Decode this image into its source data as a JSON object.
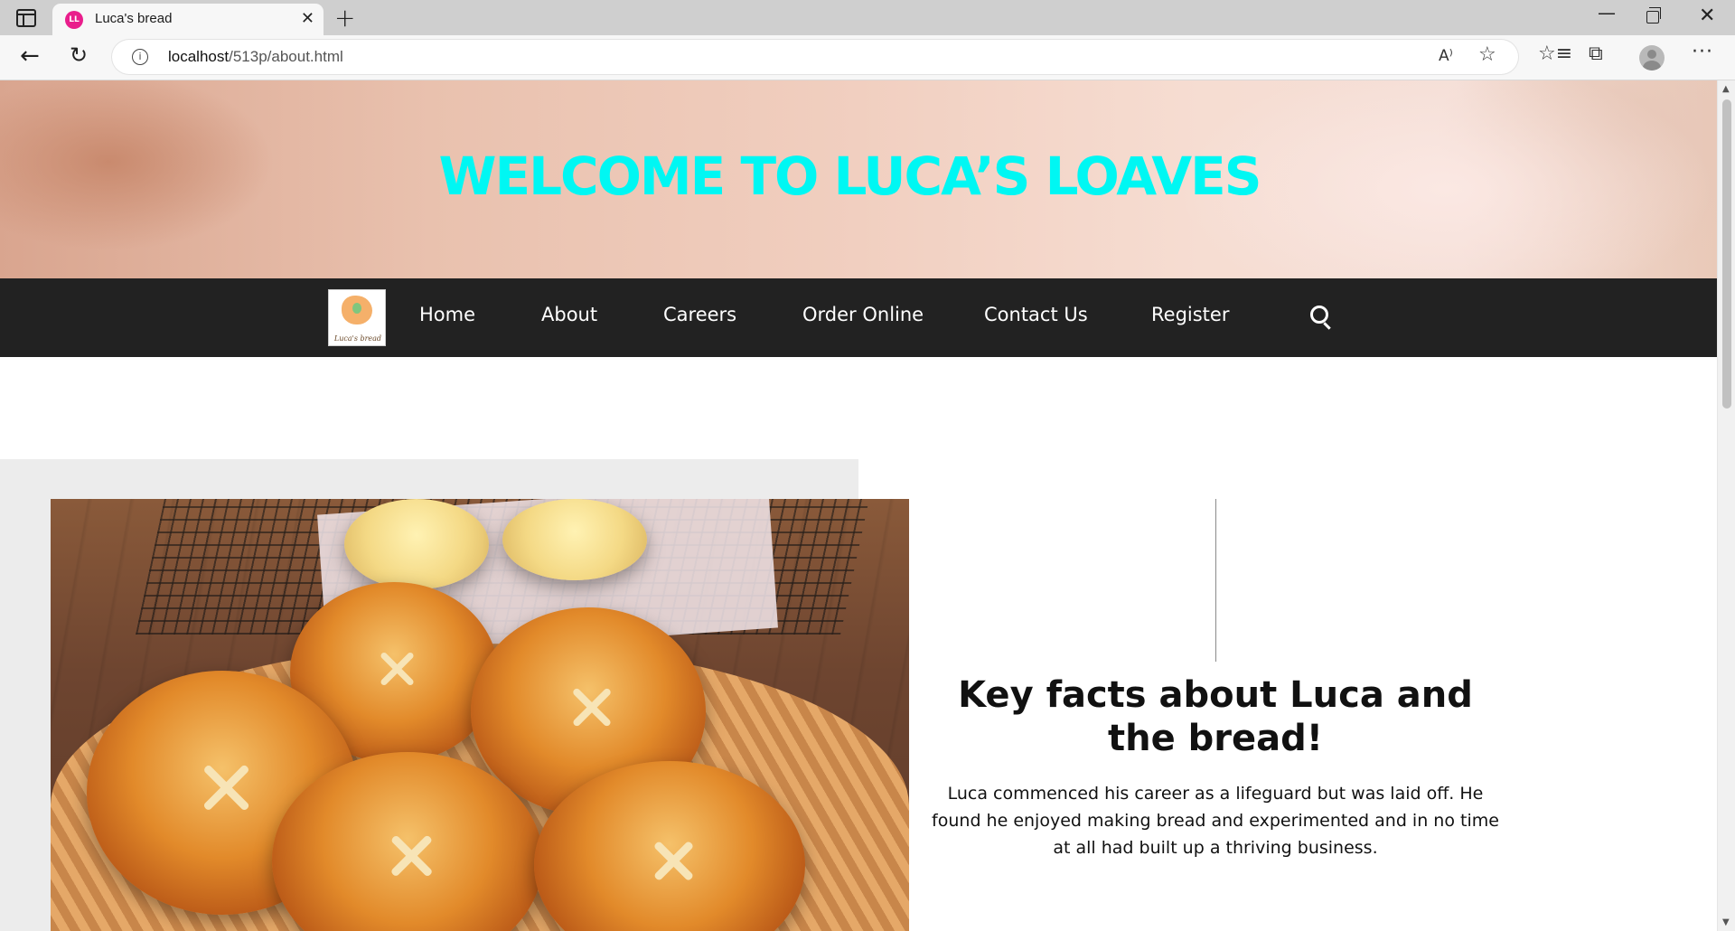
{
  "browser": {
    "tab_title": "Luca's bread",
    "tab_favicon_text": "LL",
    "tab_close": "✕",
    "new_tab": "+",
    "url_host": "localhost",
    "url_path": "/513p/about.html",
    "read_aloud": "A⁾",
    "win_minimize": "—",
    "win_close": "✕",
    "back": "←",
    "reload": "↻",
    "favorites_star": "☆",
    "favorites_list": "☆≡",
    "collections": "⧉",
    "more": "···"
  },
  "hero": {
    "title": "WELCOME TO LUCA’S LOAVES"
  },
  "nav": {
    "logo_text": "Luca's bread",
    "items": [
      "Home",
      "About",
      "Careers",
      "Order Online",
      "Contact Us",
      "Register"
    ]
  },
  "about": {
    "heading": "Key facts about Luca and the bread!",
    "body": "Luca commenced his career as a lifeguard but was laid off. He found he enjoyed making bread and experimented and in no time at all had built up a thriving business."
  },
  "colors": {
    "accent_title": "#00f7f3",
    "navbar_bg": "#222222"
  }
}
